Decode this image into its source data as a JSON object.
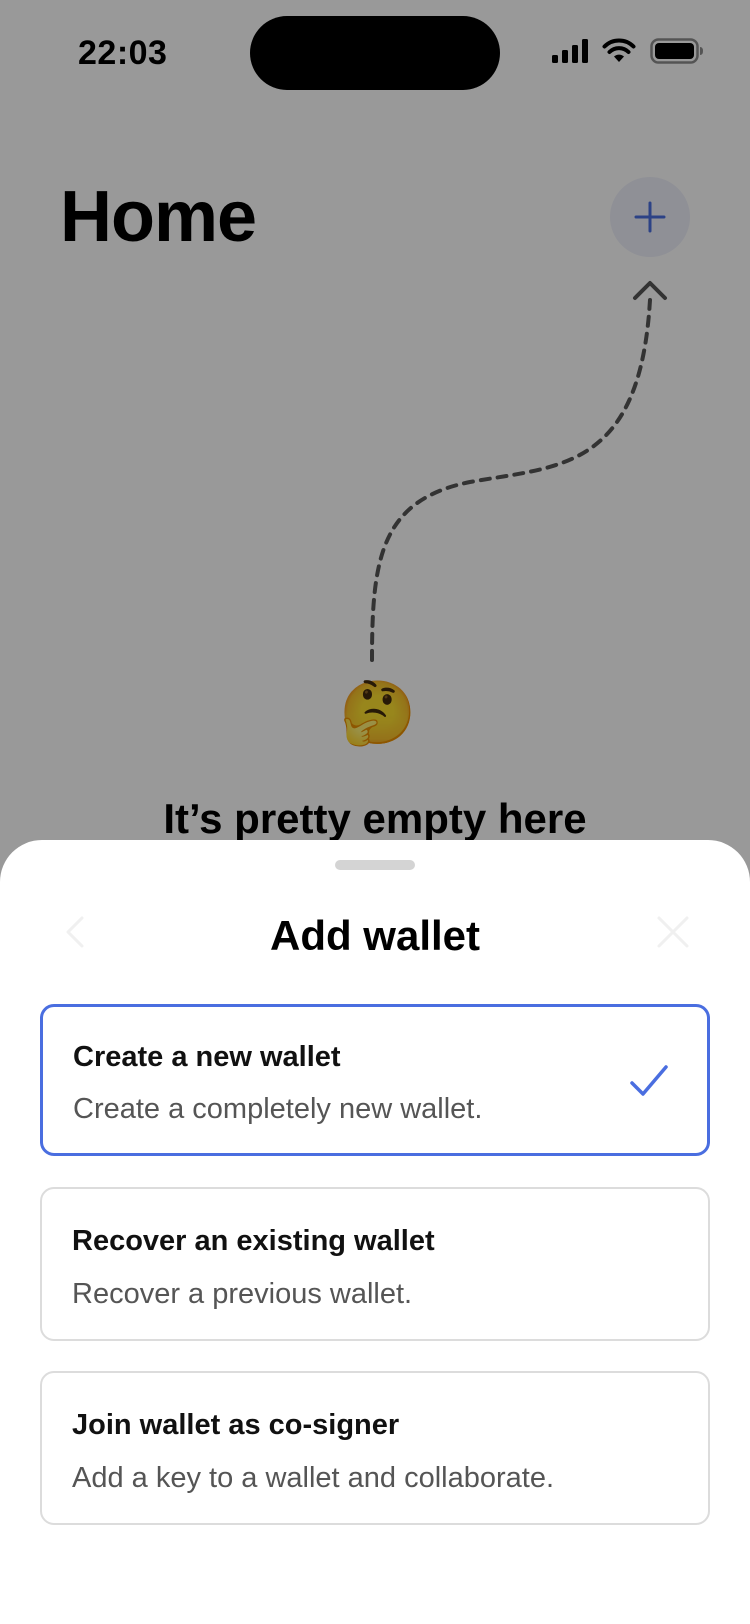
{
  "status_bar": {
    "time": "22:03",
    "icons": [
      "cellular-signal-icon",
      "wifi-icon",
      "battery-icon"
    ]
  },
  "home": {
    "title": "Home",
    "add_button_icon": "plus-icon",
    "empty_emoji": "🤔",
    "empty_title": "It’s pretty empty here"
  },
  "sheet": {
    "title": "Add wallet",
    "back_icon": "chevron-left-icon",
    "close_icon": "close-icon",
    "options": [
      {
        "title": "Create a new wallet",
        "description": "Create a completely new wallet.",
        "selected": true
      },
      {
        "title": "Recover an existing wallet",
        "description": "Recover a previous wallet.",
        "selected": false
      },
      {
        "title": "Join wallet as co-signer",
        "description": "Add a key to a wallet and collaborate.",
        "selected": false
      }
    ]
  },
  "colors": {
    "accent": "#4a6ee0",
    "overlay": "rgba(0,0,0,0.4)",
    "border": "#dcdcdc"
  }
}
